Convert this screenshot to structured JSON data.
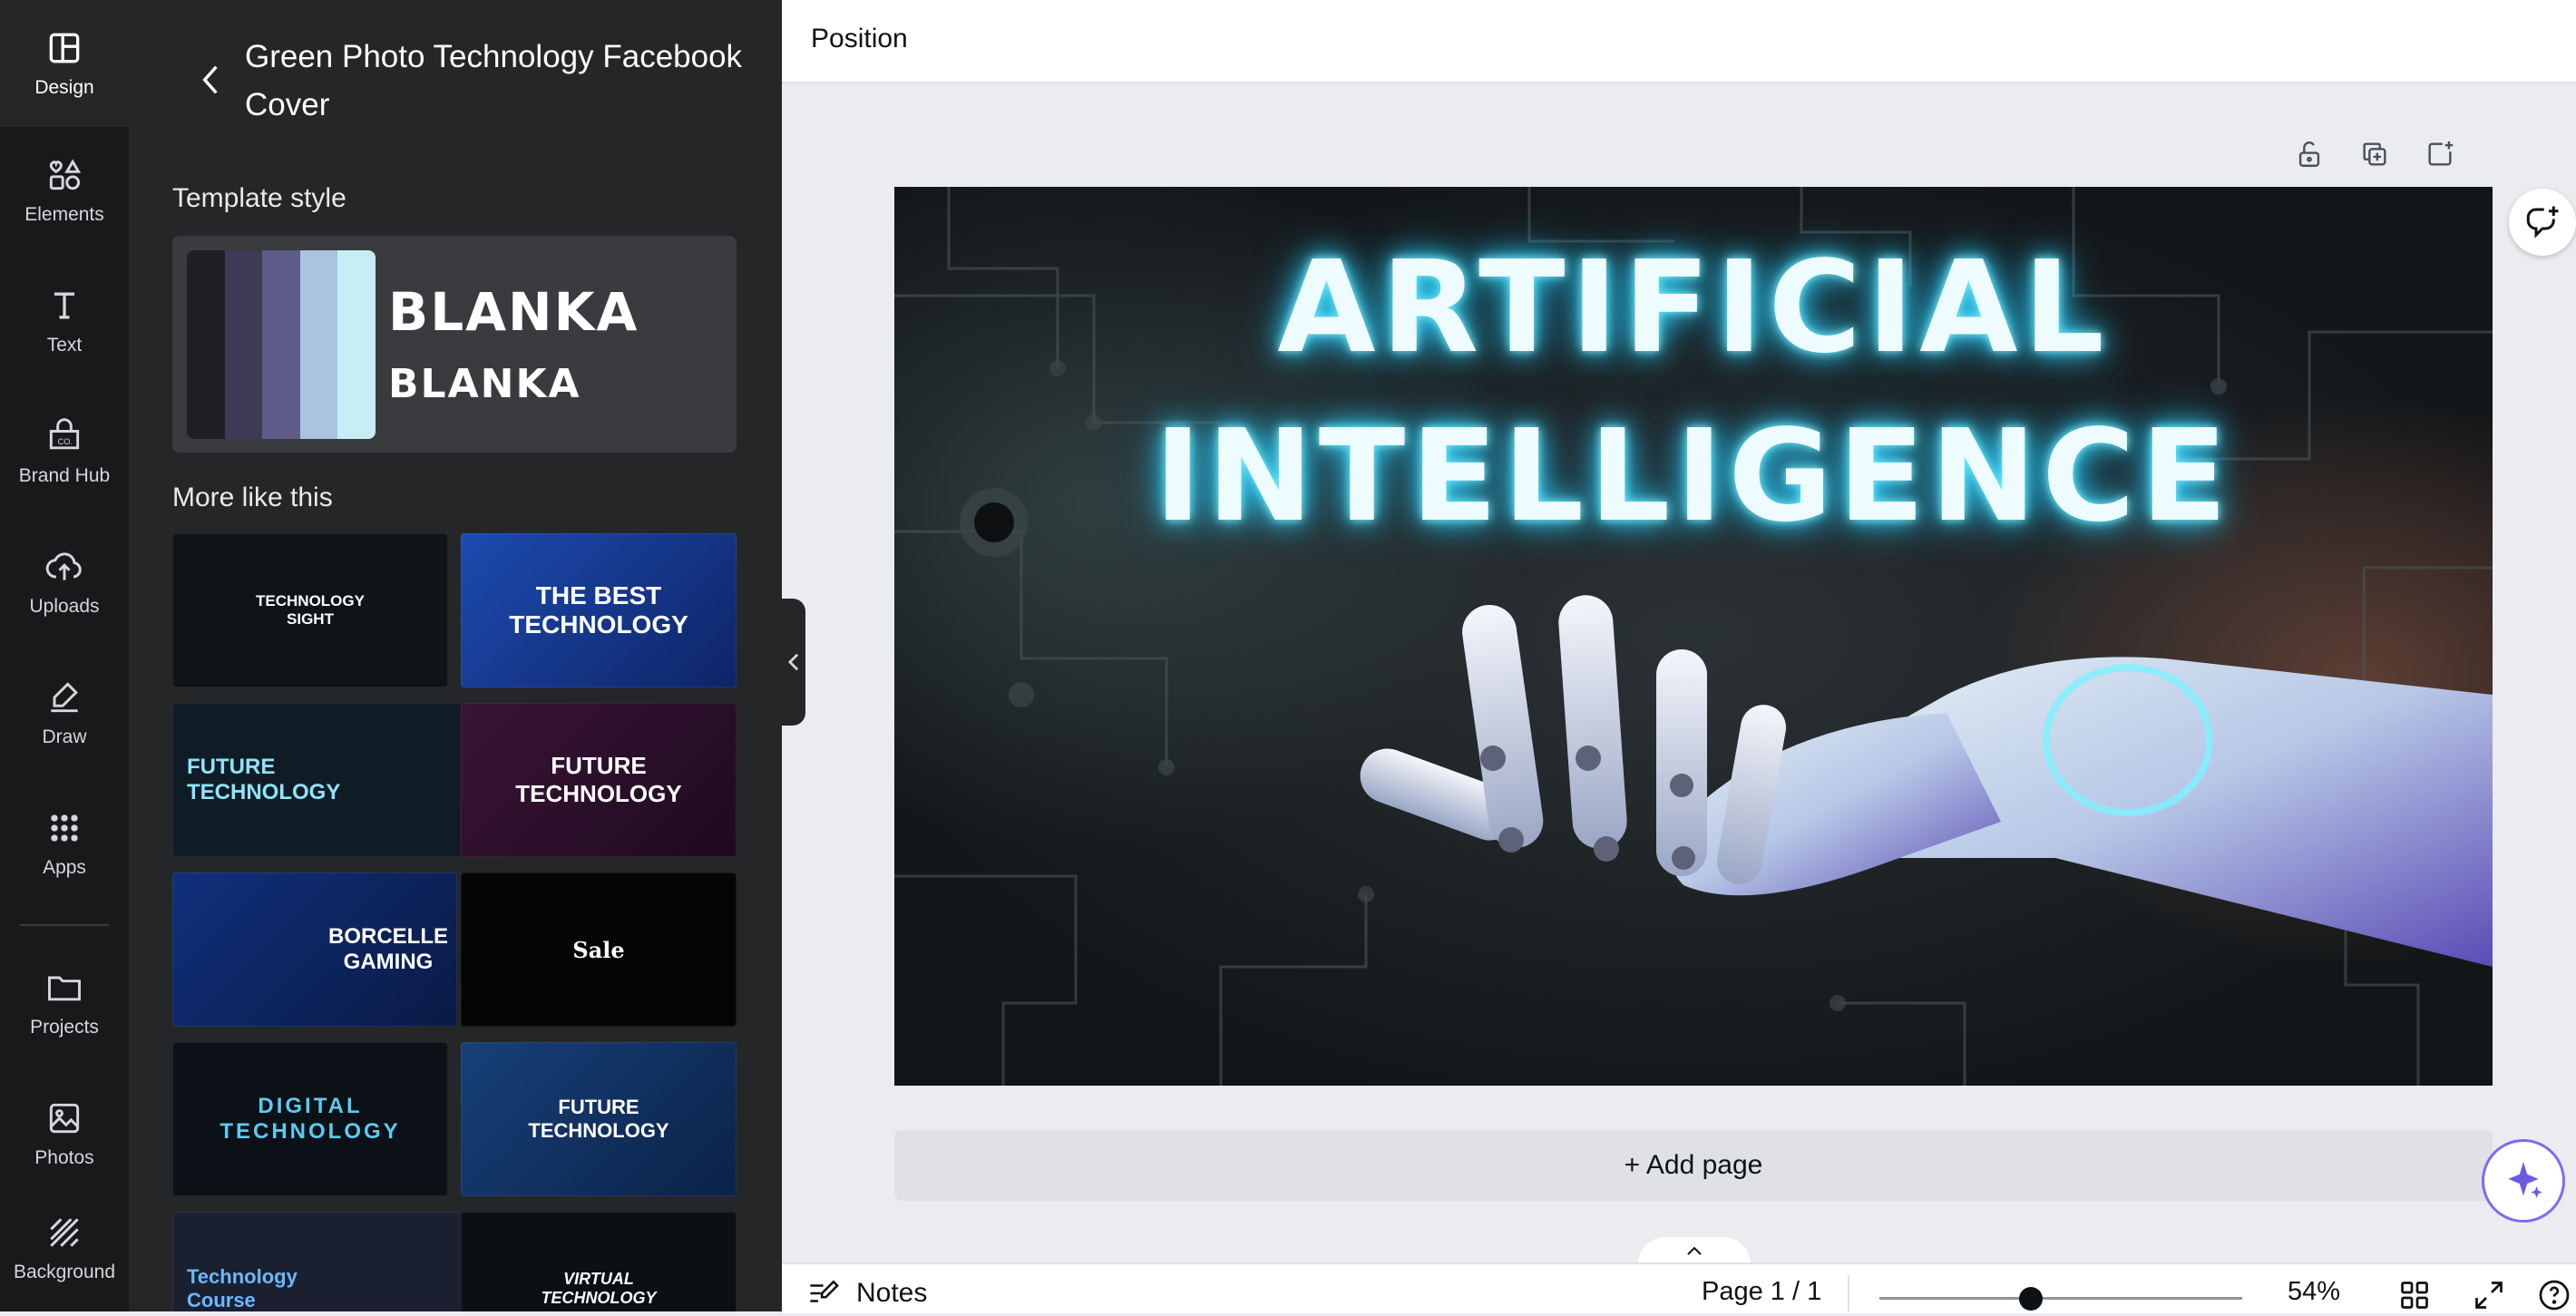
{
  "rail": {
    "items": [
      {
        "label": "Design",
        "icon": "layout-icon"
      },
      {
        "label": "Elements",
        "icon": "shapes-icon"
      },
      {
        "label": "Text",
        "icon": "text-icon"
      },
      {
        "label": "Brand Hub",
        "icon": "brand-icon"
      },
      {
        "label": "Uploads",
        "icon": "cloud-upload-icon"
      },
      {
        "label": "Draw",
        "icon": "pen-icon"
      },
      {
        "label": "Apps",
        "icon": "apps-grid-icon"
      },
      {
        "label": "Projects",
        "icon": "folder-icon"
      },
      {
        "label": "Photos",
        "icon": "image-icon"
      },
      {
        "label": "Background",
        "icon": "stripes-icon"
      }
    ],
    "active_index": 0
  },
  "panel": {
    "title": "Green Photo Technology Facebook Cover",
    "template_style_heading": "Template style",
    "style_font_sample": "BLANKA",
    "swatches": [
      "#1f2023",
      "#3c3a55",
      "#5f5c8a",
      "#a9c4dc",
      "#c8eef5"
    ],
    "more_like_this_heading": "More like this",
    "templates": [
      {
        "text": "TECHNOLOGY\nSIGHT",
        "bg": "#111417",
        "fg": "#ffffff"
      },
      {
        "text": "THE BEST\nTECHNOLOGY",
        "bg": "#173a8c",
        "fg": "#ffffff"
      },
      {
        "text": "FUTURE\nTECHNOLOGY",
        "bg": "#0f1c25",
        "fg": "#8ee3ff"
      },
      {
        "text": "FUTURE\nTECHNOLOGY",
        "bg": "#2a1028",
        "fg": "#ffffff"
      },
      {
        "text": "BORCELLE\nGAMING",
        "bg": "#0c1b46",
        "fg": "#ffffff"
      },
      {
        "text": "Sale",
        "bg": "#050505",
        "fg": "#ffffff"
      },
      {
        "text": "DIGITAL\nTECHNOLOGY",
        "bg": "#0b1116",
        "fg": "#5ccaf0"
      },
      {
        "text": "FUTURE\nTECHNOLOGY",
        "bg": "#0d2a52",
        "fg": "#ffffff"
      },
      {
        "text": "Technology\nCourse",
        "bg": "#1a2030",
        "fg": "#6ab8ff"
      },
      {
        "text": "VIRTUAL\nTECHNOLOGY",
        "bg": "#0c0f14",
        "fg": "#ffffff"
      }
    ]
  },
  "topbar": {
    "position_label": "Position"
  },
  "canvas": {
    "headline_line1": "ARTIFICIAL",
    "headline_line2": "INTELLIGENCE"
  },
  "add_page_label": "+ Add page",
  "bottombar": {
    "notes_label": "Notes",
    "page_indicator": "Page 1 / 1",
    "zoom_label": "54%",
    "zoom_value": 54
  },
  "colors": {
    "rail_bg": "#18191b",
    "panel_bg": "#252627",
    "workspace_bg": "#ebecf0",
    "accent": "#7d6af6",
    "neon": "#7ef1ff"
  }
}
